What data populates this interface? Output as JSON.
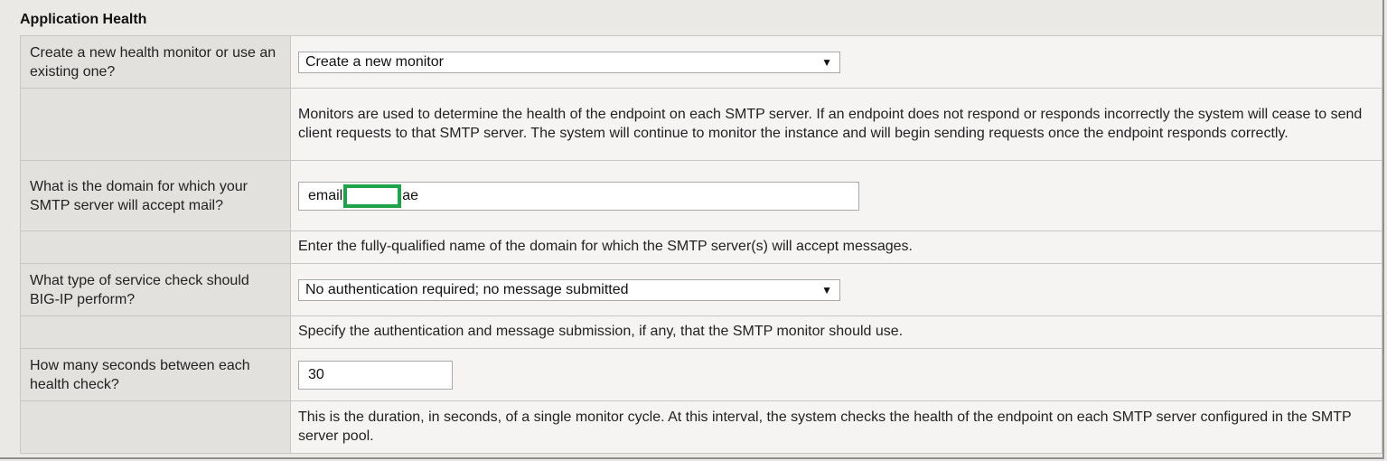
{
  "section": {
    "title": "Application Health"
  },
  "rows": {
    "monitor": {
      "question": "Create a new health monitor or use an existing one?",
      "selected": "Create a new monitor",
      "help": "Monitors are used to determine the health of the endpoint on each SMTP server. If an endpoint does not respond or responds incorrectly the system will cease to send client requests to that SMTP server. The system will continue to monitor the instance and will begin sending requests once the endpoint responds correctly."
    },
    "domain": {
      "question": "What is the domain for which your SMTP server will accept mail?",
      "value_prefix": "email",
      "value_suffix": "ae",
      "redaction_color": "#1fa34a",
      "help": "Enter the fully-qualified name of the domain for which the SMTP server(s) will accept messages."
    },
    "service_check": {
      "question": "What type of service check should BIG-IP perform?",
      "selected": "No authentication required; no message submitted",
      "help": "Specify the authentication and message submission, if any, that the SMTP monitor should use."
    },
    "interval": {
      "question": "How many seconds between each health check?",
      "value": "30",
      "help": "This is the duration, in seconds, of a single monitor cycle. At this interval, the system checks the health of the endpoint on each SMTP server configured in the SMTP server pool."
    }
  },
  "icons": {
    "dropdown_arrow": "▼"
  }
}
